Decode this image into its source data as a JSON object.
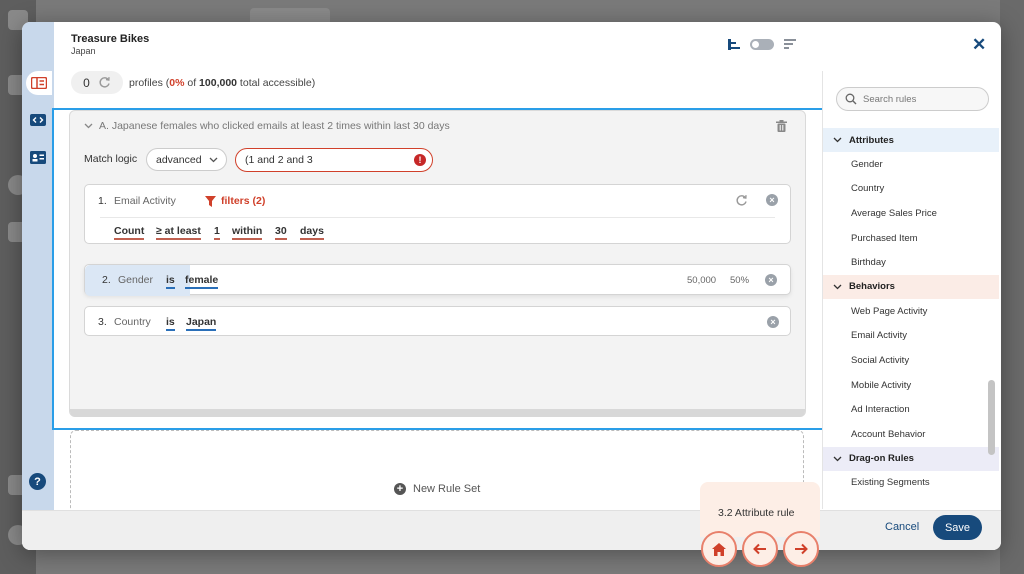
{
  "modal": {
    "title": "Treasure Bikes",
    "subtitle": "Japan",
    "close": "✕"
  },
  "profiles": {
    "count": "0",
    "prefix": "profiles (",
    "percent": "0%",
    "of": " of ",
    "total": "100,000",
    "suffix": " total accessible)"
  },
  "ruleset": {
    "title": "A. Japanese females who clicked emails at least 2 times within last 30 days",
    "match_logic_label": "Match logic",
    "match_logic_value": "advanced",
    "logic_expression": "(1 and 2 and 3",
    "error_mark": "!",
    "rules": [
      {
        "num": "1.",
        "label": "Email Activity",
        "filters": "filters (2)",
        "tokens": [
          "Count",
          "≥ at least",
          "1",
          "within",
          "30",
          "days"
        ]
      },
      {
        "num": "2.",
        "label": "Gender",
        "op": "is",
        "value": "female",
        "count": "50,000",
        "pct": "50%"
      },
      {
        "num": "3.",
        "label": "Country",
        "op": "is",
        "value": "Japan"
      }
    ],
    "new_rule_set": "New Rule Set"
  },
  "panel": {
    "search_placeholder": "Search rules",
    "groups": [
      {
        "name": "Attributes",
        "items": [
          "Gender",
          "Country",
          "Average Sales Price",
          "Purchased Item",
          "Birthday"
        ]
      },
      {
        "name": "Behaviors",
        "items": [
          "Web Page Activity",
          "Email Activity",
          "Social Activity",
          "Mobile Activity",
          "Ad Interaction",
          "Account Behavior"
        ]
      },
      {
        "name": "Drag-on Rules",
        "items": [
          "Existing Segments"
        ]
      }
    ]
  },
  "footer": {
    "cancel": "Cancel",
    "save": "Save"
  },
  "tour": {
    "step": "3.2 Attribute rule"
  },
  "help": "?",
  "colors": {
    "brand_blue": "#174a7c",
    "highlight_frame": "#2a9ee8",
    "accent_red": "#d0402a"
  }
}
